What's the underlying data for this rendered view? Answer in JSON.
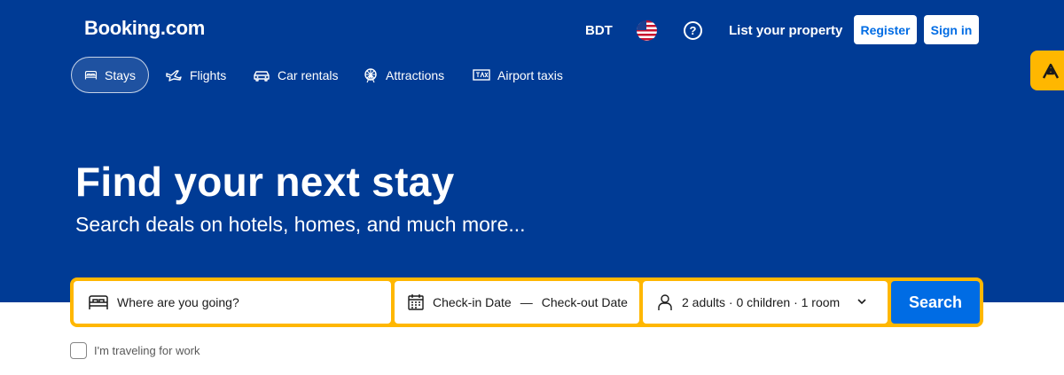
{
  "header": {
    "logo": "Booking.com",
    "currency": "BDT",
    "help_symbol": "?",
    "list_property": "List your property",
    "register": "Register",
    "sign_in": "Sign in"
  },
  "nav": {
    "tabs": [
      {
        "label": "Stays",
        "icon": "bed-icon",
        "active": true
      },
      {
        "label": "Flights",
        "icon": "plane-icon"
      },
      {
        "label": "Car rentals",
        "icon": "car-icon"
      },
      {
        "label": "Attractions",
        "icon": "ferris-wheel-icon"
      },
      {
        "label": "Airport taxis",
        "icon": "taxi-icon"
      }
    ]
  },
  "hero": {
    "title": "Find your next stay",
    "subtitle": "Search deals on hotels, homes, and much more..."
  },
  "search": {
    "destination_placeholder": "Where are you going?",
    "checkin": "Check-in Date",
    "separator": "—",
    "checkout": "Check-out Date",
    "guests": "2 adults · 0 children · 1 room",
    "button": "Search"
  },
  "work_travel": {
    "label": "I'm traveling for work",
    "checked": false
  },
  "colors": {
    "brand_blue": "#003b95",
    "accent_yellow": "#ffb700",
    "action_blue": "#006ce4"
  }
}
